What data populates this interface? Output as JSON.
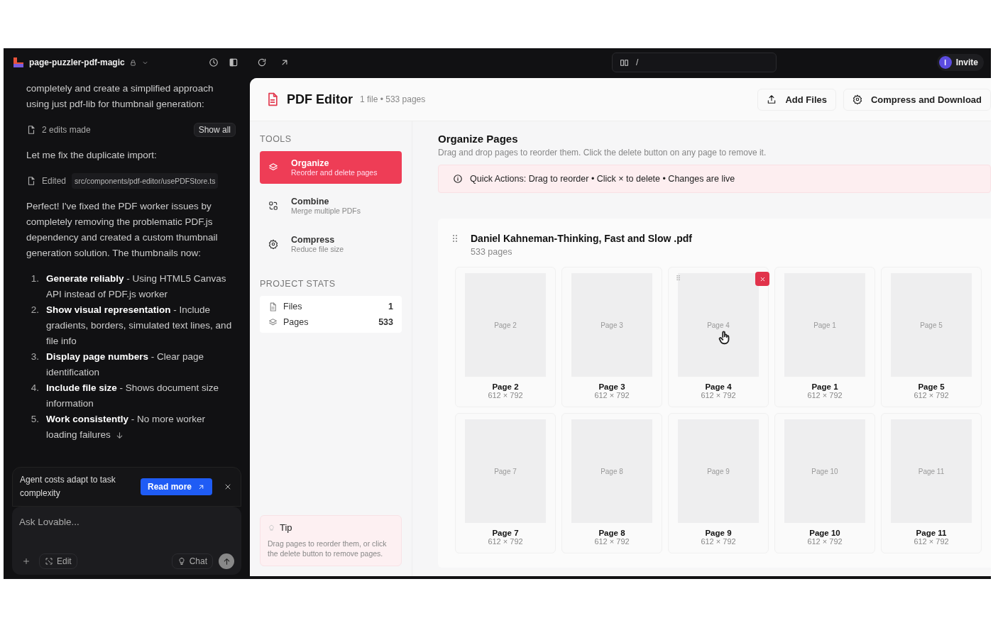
{
  "topbar": {
    "project": "page-puzzler-pdf-magic",
    "url": "/",
    "avatar": "I",
    "invite": "Invite"
  },
  "chat": {
    "messages": [
      {
        "kind": "text",
        "text": "completely and create a simplified approach using just pdf-lib for thumbnail generation:"
      },
      {
        "kind": "edits",
        "label": "2 edits made",
        "action": "Show all"
      },
      {
        "kind": "text",
        "text": "Let me fix the duplicate import:"
      },
      {
        "kind": "edited",
        "label": "Edited",
        "file": "src/components/pdf-editor/usePDFStore.ts"
      },
      {
        "kind": "text",
        "text": "Perfect! I've fixed the PDF worker issues by completely removing the problematic PDF.js dependency and created a custom thumbnail generation solution. The thumbnails now:"
      },
      {
        "kind": "list",
        "items": [
          {
            "marker": "1.",
            "text": "**Generate reliably** - Using HTML5 Canvas API instead of PDF.js worker"
          },
          {
            "marker": "2.",
            "text": "**Show visual representation** - Include gradients, borders, simulated text lines, and file info"
          },
          {
            "marker": "3.",
            "text": "**Display page numbers** - Clear page identification"
          },
          {
            "marker": "4.",
            "text": "**Include file size** - Shows document size information"
          },
          {
            "marker": "5.",
            "text": "**Work consistently** - No more worker loading failures"
          }
        ]
      }
    ],
    "notice": {
      "text": "Agent costs adapt to task complexity",
      "button": "Read more"
    },
    "input": {
      "placeholder": "Ask Lovable...",
      "edit": "Edit",
      "chat": "Chat"
    }
  },
  "editor": {
    "title": "PDF Editor",
    "meta": "1 file • 533 pages",
    "actions": [
      {
        "kind": "upload",
        "label": "Add Files"
      },
      {
        "kind": "gear",
        "label": "Compress and Download"
      }
    ],
    "tools_heading": "TOOLS",
    "tools": [
      {
        "kind": "layers",
        "name": "Organize",
        "desc": "Reorder and delete pages",
        "selected": true
      },
      {
        "kind": "combine",
        "name": "Combine",
        "desc": "Merge multiple PDFs",
        "selected": false
      },
      {
        "kind": "gear",
        "name": "Compress",
        "desc": "Reduce file size",
        "selected": false
      }
    ],
    "stats_heading": "PROJECT STATS",
    "stats": [
      {
        "kind": "file",
        "label": "Files",
        "value": "1"
      },
      {
        "kind": "layers",
        "label": "Pages",
        "value": "533"
      }
    ],
    "tip": {
      "title": "Tip",
      "text": "Drag pages to reorder them, or click the delete button to remove pages."
    },
    "main": {
      "title": "Organize Pages",
      "subtitle": "Drag and drop pages to reorder them. Click the delete button on any page to remove it.",
      "banner": "Quick Actions: Drag to reorder • Click × to delete • Changes are live",
      "file": {
        "name": "Daniel Kahneman-Thinking, Fast and Slow .pdf",
        "pages_count": "533 pages",
        "pages": [
          {
            "thumb": "Page 2",
            "name": "Page 2",
            "size": "612 × 792",
            "hovered": false
          },
          {
            "thumb": "Page 3",
            "name": "Page 3",
            "size": "612 × 792",
            "hovered": false
          },
          {
            "thumb": "Page 4",
            "name": "Page 4",
            "size": "612 × 792",
            "hovered": true
          },
          {
            "thumb": "Page 1",
            "name": "Page 1",
            "size": "612 × 792",
            "hovered": false
          },
          {
            "thumb": "Page 5",
            "name": "Page 5",
            "size": "612 × 792",
            "hovered": false
          },
          {
            "thumb": "Page 7",
            "name": "Page 7",
            "size": "612 × 792",
            "hovered": false
          },
          {
            "thumb": "Page 8",
            "name": "Page 8",
            "size": "612 × 792",
            "hovered": false
          },
          {
            "thumb": "Page 9",
            "name": "Page 9",
            "size": "612 × 792",
            "hovered": false
          },
          {
            "thumb": "Page 10",
            "name": "Page 10",
            "size": "612 × 792",
            "hovered": false
          },
          {
            "thumb": "Page 11",
            "name": "Page 11",
            "size": "612 × 792",
            "hovered": false
          }
        ]
      }
    }
  }
}
